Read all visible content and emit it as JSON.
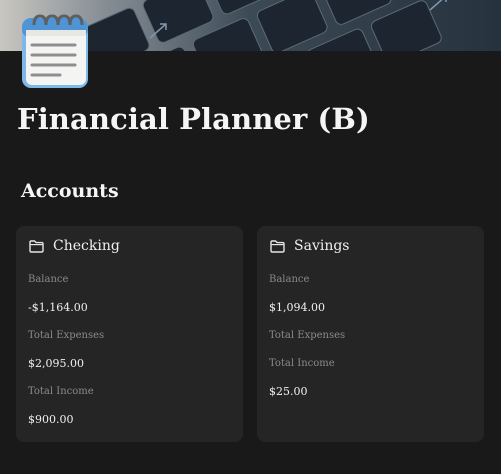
{
  "page": {
    "title": "Financial Planner (B)",
    "icon": "notepad-icon",
    "cover": "keyboard-photo"
  },
  "accounts": {
    "heading": "Accounts",
    "cards": [
      {
        "icon": "folder-icon",
        "name": "Checking",
        "properties": [
          {
            "label": "Balance",
            "value": "-$1,164.00"
          },
          {
            "label": "Total Expenses",
            "value": "$2,095.00"
          },
          {
            "label": "Total Income",
            "value": "$900.00"
          }
        ]
      },
      {
        "icon": "folder-icon",
        "name": "Savings",
        "properties": [
          {
            "label": "Balance",
            "value": "$1,094.00"
          },
          {
            "label": "Total Expenses",
            "value": ""
          },
          {
            "label": "Total Income",
            "value": "$25.00"
          }
        ]
      }
    ]
  },
  "colors": {
    "background": "#191919",
    "card": "#252525",
    "text": "#f0f0f0",
    "muted": "#8a8a8a"
  }
}
